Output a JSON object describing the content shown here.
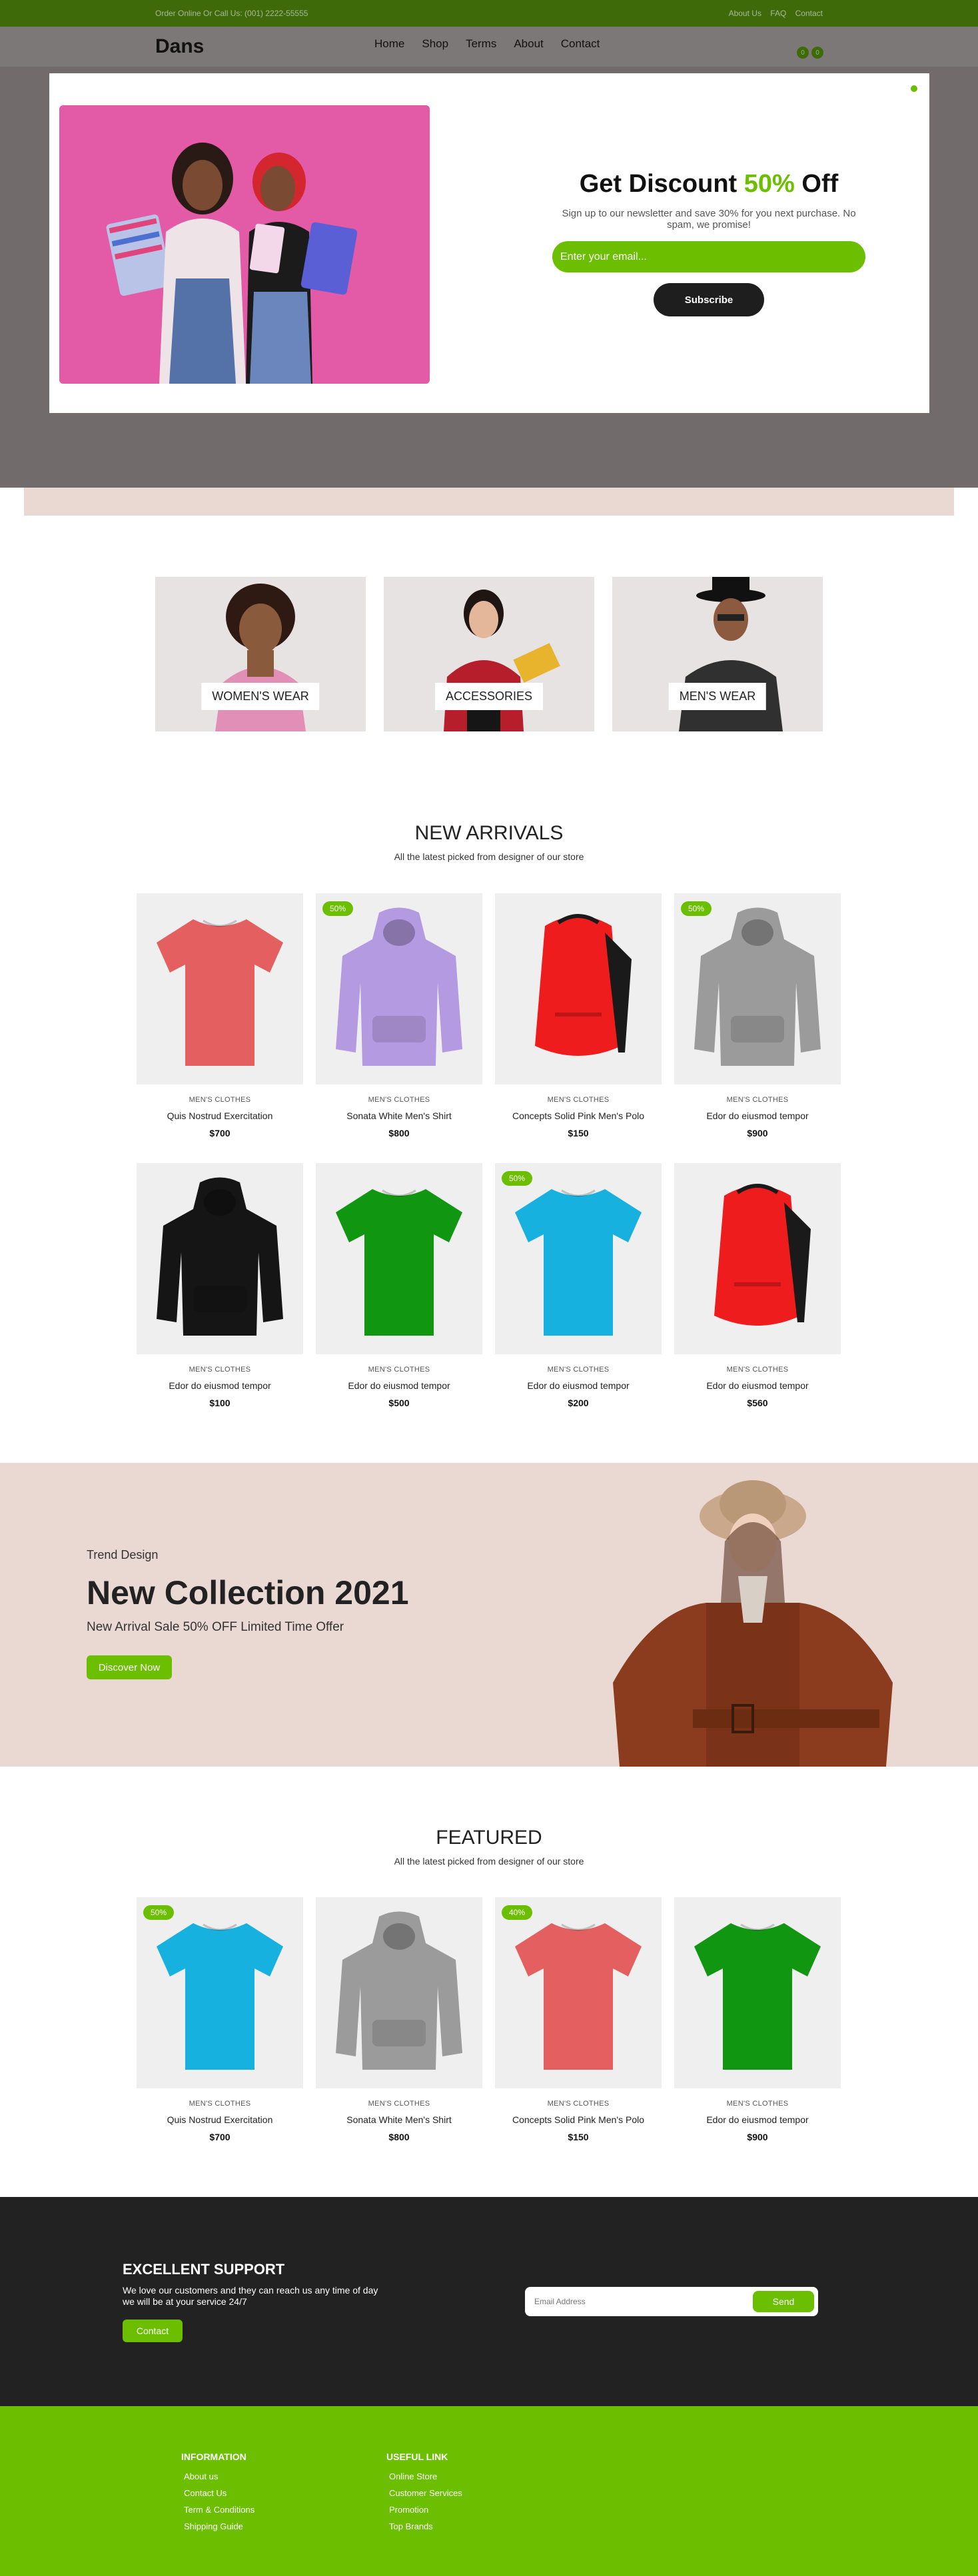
{
  "topbar": {
    "contact": "Order Online Or Call Us: (001) 2222-55555",
    "links": [
      "About Us",
      "FAQ",
      "Contact"
    ]
  },
  "header": {
    "logo": "Dans",
    "nav": [
      "Home",
      "Shop",
      "Terms",
      "About",
      "Contact"
    ],
    "badges": [
      "0",
      "0"
    ]
  },
  "popup": {
    "title_start": "Get Discount ",
    "title_pct": "50%",
    "title_end": " Off",
    "text": "Sign up to our newsletter and save 30% for you next purchase. No spam, we promise!",
    "email_placeholder": "Enter your email...",
    "subscribe": "Subscribe"
  },
  "categories": [
    "WOMEN'S WEAR",
    "ACCESSORIES",
    "MEN'S WEAR"
  ],
  "new_arrivals": {
    "title": "NEW ARRIVALS",
    "subtitle": "All the latest picked from designer of our store",
    "products": [
      {
        "category": "MEN'S CLOTHES",
        "name": "Quis Nostrud Exercitation",
        "price": "$700",
        "badge": "",
        "item": "tshirt",
        "color": "#e45f5f"
      },
      {
        "category": "MEN'S CLOTHES",
        "name": "Sonata White Men's Shirt",
        "price": "$800",
        "badge": "50%",
        "item": "hoodie",
        "color": "#b49ae0"
      },
      {
        "category": "MEN'S CLOTHES",
        "name": "Concepts Solid Pink Men's Polo",
        "price": "$150",
        "badge": "",
        "item": "backpack",
        "color": "#ee1c1c"
      },
      {
        "category": "MEN'S CLOTHES",
        "name": "Edor do eiusmod tempor",
        "price": "$900",
        "badge": "50%",
        "item": "hoodie",
        "color": "#9b9b9b"
      },
      {
        "category": "MEN'S CLOTHES",
        "name": "Edor do eiusmod tempor",
        "price": "$100",
        "badge": "",
        "item": "hoodie",
        "color": "#151515"
      },
      {
        "category": "MEN'S CLOTHES",
        "name": "Edor do eiusmod tempor",
        "price": "$500",
        "badge": "",
        "item": "tshirt",
        "color": "#119611"
      },
      {
        "category": "MEN'S CLOTHES",
        "name": "Edor do eiusmod tempor",
        "price": "$200",
        "badge": "50%",
        "item": "tshirt",
        "color": "#17b1e0"
      },
      {
        "category": "MEN'S CLOTHES",
        "name": "Edor do eiusmod tempor",
        "price": "$560",
        "badge": "",
        "item": "backpack",
        "color": "#ee1c1c"
      }
    ]
  },
  "promo": {
    "eyebrow": "Trend Design",
    "title": "New Collection 2021",
    "subtitle": "New Arrival Sale 50% OFF Limited Time Offer",
    "button": "Discover Now"
  },
  "featured": {
    "title": "FEATURED",
    "subtitle": "All the latest picked from designer of our store",
    "products": [
      {
        "category": "MEN'S CLOTHES",
        "name": "Quis Nostrud Exercitation",
        "price": "$700",
        "badge": "50%",
        "item": "tshirt",
        "color": "#17b1e0"
      },
      {
        "category": "MEN'S CLOTHES",
        "name": "Sonata White Men's Shirt",
        "price": "$800",
        "badge": "",
        "item": "hoodie",
        "color": "#9b9b9b"
      },
      {
        "category": "MEN'S CLOTHES",
        "name": "Concepts Solid Pink Men's Polo",
        "price": "$150",
        "badge": "40%",
        "item": "tshirt",
        "color": "#e45f5f"
      },
      {
        "category": "MEN'S CLOTHES",
        "name": "Edor do eiusmod tempor",
        "price": "$900",
        "badge": "",
        "item": "tshirt",
        "color": "#119611"
      }
    ]
  },
  "support": {
    "title": "EXCELLENT SUPPORT",
    "text": "We love our customers and they can reach us any time of day we will be at your service 24/7",
    "button": "Contact",
    "email_placeholder": "Email Address",
    "send": "Send"
  },
  "footer": {
    "information": {
      "title": "INFORMATION",
      "links": [
        "About us",
        "Contact Us",
        "Term & Conditions",
        "Shipping Guide"
      ]
    },
    "useful": {
      "title": "USEFUL LINK",
      "links": [
        "Online Store",
        "Customer Services",
        "Promotion",
        "Top Brands"
      ]
    }
  },
  "colors": {
    "accent": "#6bbf00",
    "topbar": "#3f6a09",
    "dark": "#222222",
    "promo_bg": "#ead8d2"
  }
}
